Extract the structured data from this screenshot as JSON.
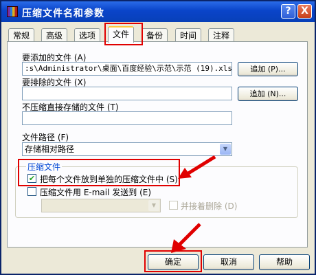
{
  "window": {
    "title": "压缩文件名和参数",
    "help_label": "?",
    "close_label": "X"
  },
  "tabs": [
    {
      "label": "常规"
    },
    {
      "label": "高级"
    },
    {
      "label": "选项"
    },
    {
      "label": "文件"
    },
    {
      "label": "备份"
    },
    {
      "label": "时间"
    },
    {
      "label": "注释"
    }
  ],
  "files_tab": {
    "add_files_label": "要添加的文件 (A)",
    "add_files_value": ":s\\Administrator\\桌面\\百度经验\\示范\\示范 (19).xlsx\"",
    "append_button_1": "追加 (P)...",
    "exclude_files_label": "要排除的文件 (X)",
    "exclude_files_value": "",
    "append_button_2": "追加 (N)...",
    "no_compress_label": "不压缩直接存储的文件 (T)",
    "no_compress_value": "",
    "file_path_label": "文件路径 (F)",
    "file_path_value": "存储相对路径",
    "group_title": "压缩文件",
    "separate_archive_label": "把每个文件放到单独的压缩文件中 (S)",
    "separate_archive_checked": true,
    "email_label": "压缩文件用 E-mail 发送到 (E)",
    "email_checked": false,
    "email_select_value": "",
    "delete_after_label": "并接着删除 (D)",
    "delete_after_checked": false
  },
  "footer": {
    "ok_label": "确定",
    "cancel_label": "取消",
    "help_label": "帮助"
  },
  "colors": {
    "highlight": "#e00000",
    "title_bar": "#0a44c9",
    "group_title": "#0046d5"
  }
}
